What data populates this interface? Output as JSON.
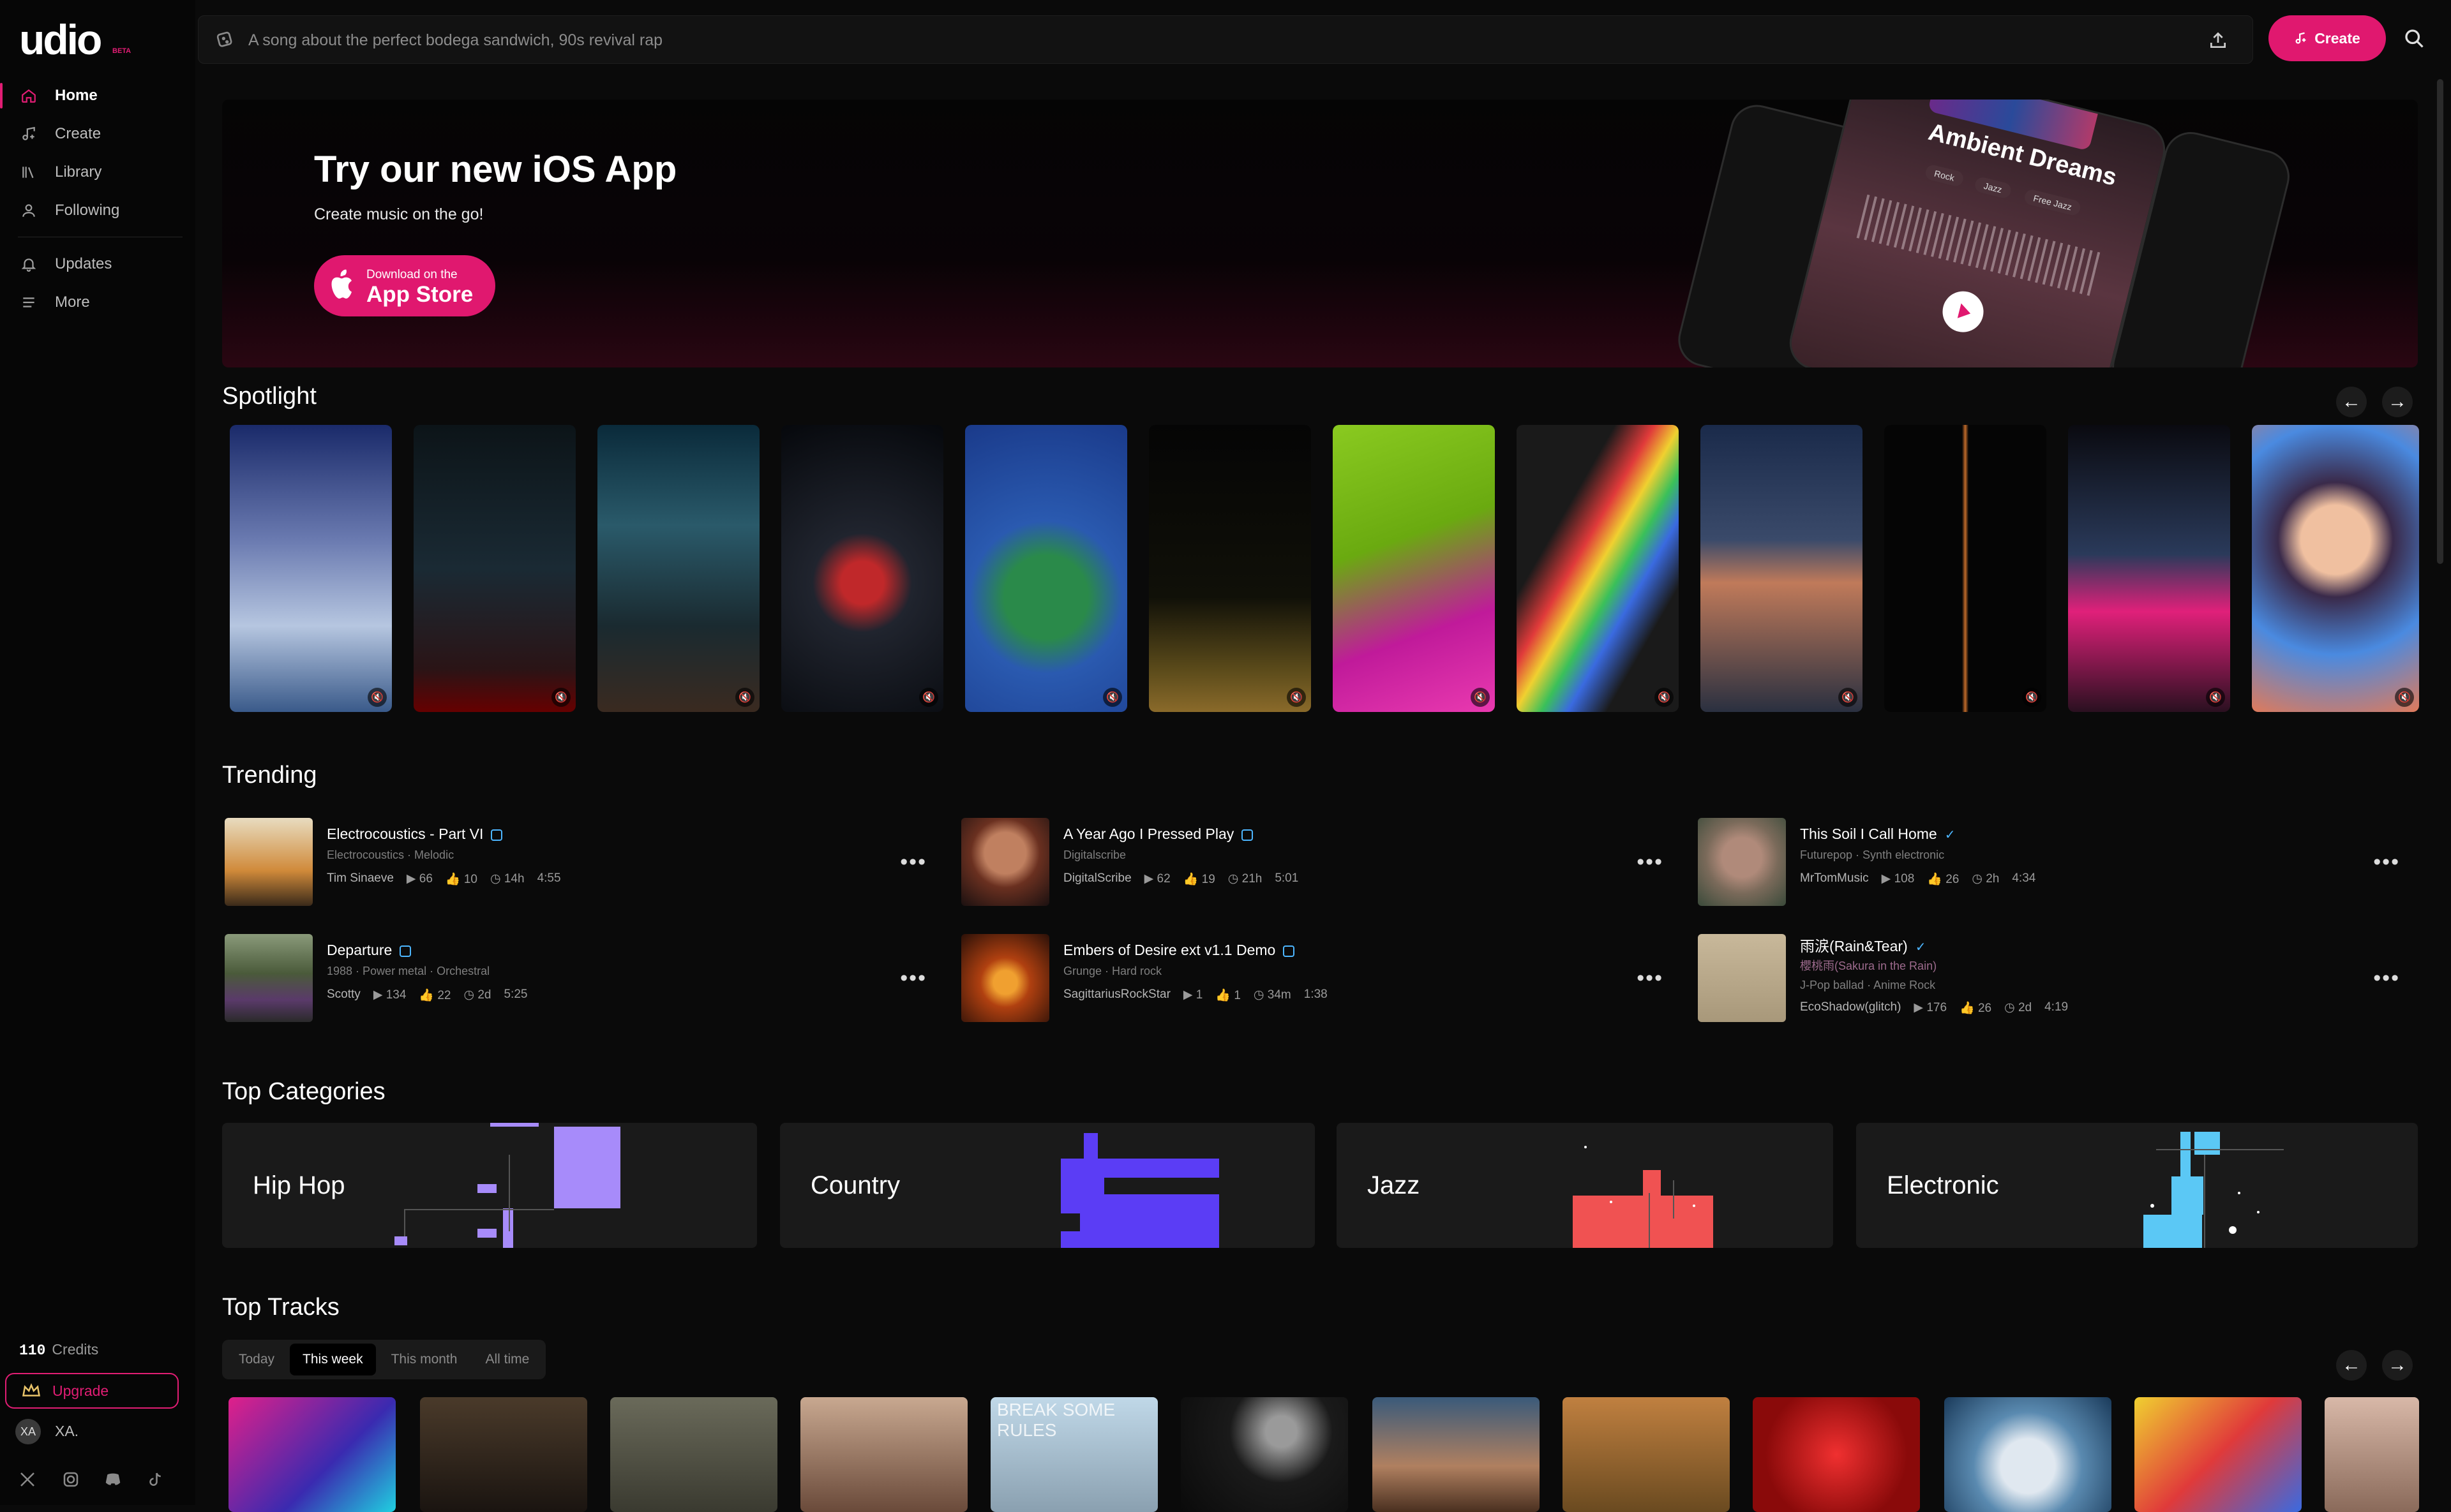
{
  "app": {
    "logo": "udio",
    "beta": "BETA"
  },
  "sidebar": {
    "items": [
      {
        "label": "Home",
        "icon": "home-icon"
      },
      {
        "label": "Create",
        "icon": "music-note-icon"
      },
      {
        "label": "Library",
        "icon": "library-icon"
      },
      {
        "label": "Following",
        "icon": "user-icon"
      },
      {
        "label": "Updates",
        "icon": "bell-icon"
      },
      {
        "label": "More",
        "icon": "menu-icon"
      }
    ],
    "credits_value": "110",
    "credits_label": "Credits",
    "upgrade_label": "Upgrade",
    "user_initials": "XA",
    "user_name": "XA."
  },
  "topbar": {
    "search_placeholder": "A song about the perfect bodega sandwich, 90s revival rap",
    "create_label": "Create"
  },
  "banner": {
    "title": "Try our new iOS App",
    "subtitle": "Create music on the go!",
    "appstore_small": "Download on the",
    "appstore_big": "App Store",
    "phone_title": "Ambient Dreams",
    "phone_tags": [
      "Rock",
      "Jazz",
      "Free Jazz"
    ]
  },
  "spotlight": {
    "title": "Spotlight"
  },
  "trending": {
    "title": "Trending",
    "items": [
      {
        "title": "Electrocoustics - Part VI",
        "genres": "Electrocoustics  ·  Melodic",
        "artist": "Tim Sinaeve",
        "plays": "66",
        "likes": "10",
        "age": "14h",
        "duration": "4:55"
      },
      {
        "title": "A Year Ago I Pressed Play",
        "genres": "Digitalscribe",
        "artist": "DigitalScribe",
        "plays": "62",
        "likes": "19",
        "age": "21h",
        "duration": "5:01"
      },
      {
        "title": "This Soil I Call Home",
        "genres": "Futurepop  ·  Synth electronic",
        "artist": "MrTomMusic",
        "plays": "108",
        "likes": "26",
        "age": "2h",
        "duration": "4:34"
      },
      {
        "title": "Departure",
        "genres": "1988  ·  Power metal  ·  Orchestral",
        "artist": "Scotty",
        "plays": "134",
        "likes": "22",
        "age": "2d",
        "duration": "5:25"
      },
      {
        "title": "Embers of Desire ext v1.1 Demo",
        "genres": "Grunge  ·  Hard rock",
        "artist": "SagittariusRockStar",
        "plays": "1",
        "likes": "1",
        "age": "34m",
        "duration": "1:38"
      },
      {
        "title": "雨涙(Rain&Tear)",
        "subtitle": "櫻桃雨(Sakura in the Rain)",
        "genres": "J-Pop ballad  ·  Anime Rock",
        "artist": "EcoShadow(glitch)",
        "plays": "176",
        "likes": "26",
        "age": "2d",
        "duration": "4:19"
      }
    ]
  },
  "categories": {
    "title": "Top Categories",
    "items": [
      {
        "label": "Hip Hop",
        "color": "#a78bfa"
      },
      {
        "label": "Country",
        "color": "#5b3df5"
      },
      {
        "label": "Jazz",
        "color": "#f05252"
      },
      {
        "label": "Electronic",
        "color": "#5bc8f5"
      }
    ]
  },
  "top_tracks": {
    "title": "Top Tracks",
    "tabs": [
      "Today",
      "This week",
      "This month",
      "All time"
    ],
    "active_tab": "This week",
    "art_text": "BREAK SOME RULES"
  },
  "colors": {
    "accent": "#e0186f",
    "background": "#0a0a0a",
    "verified": "#4db6ff"
  }
}
